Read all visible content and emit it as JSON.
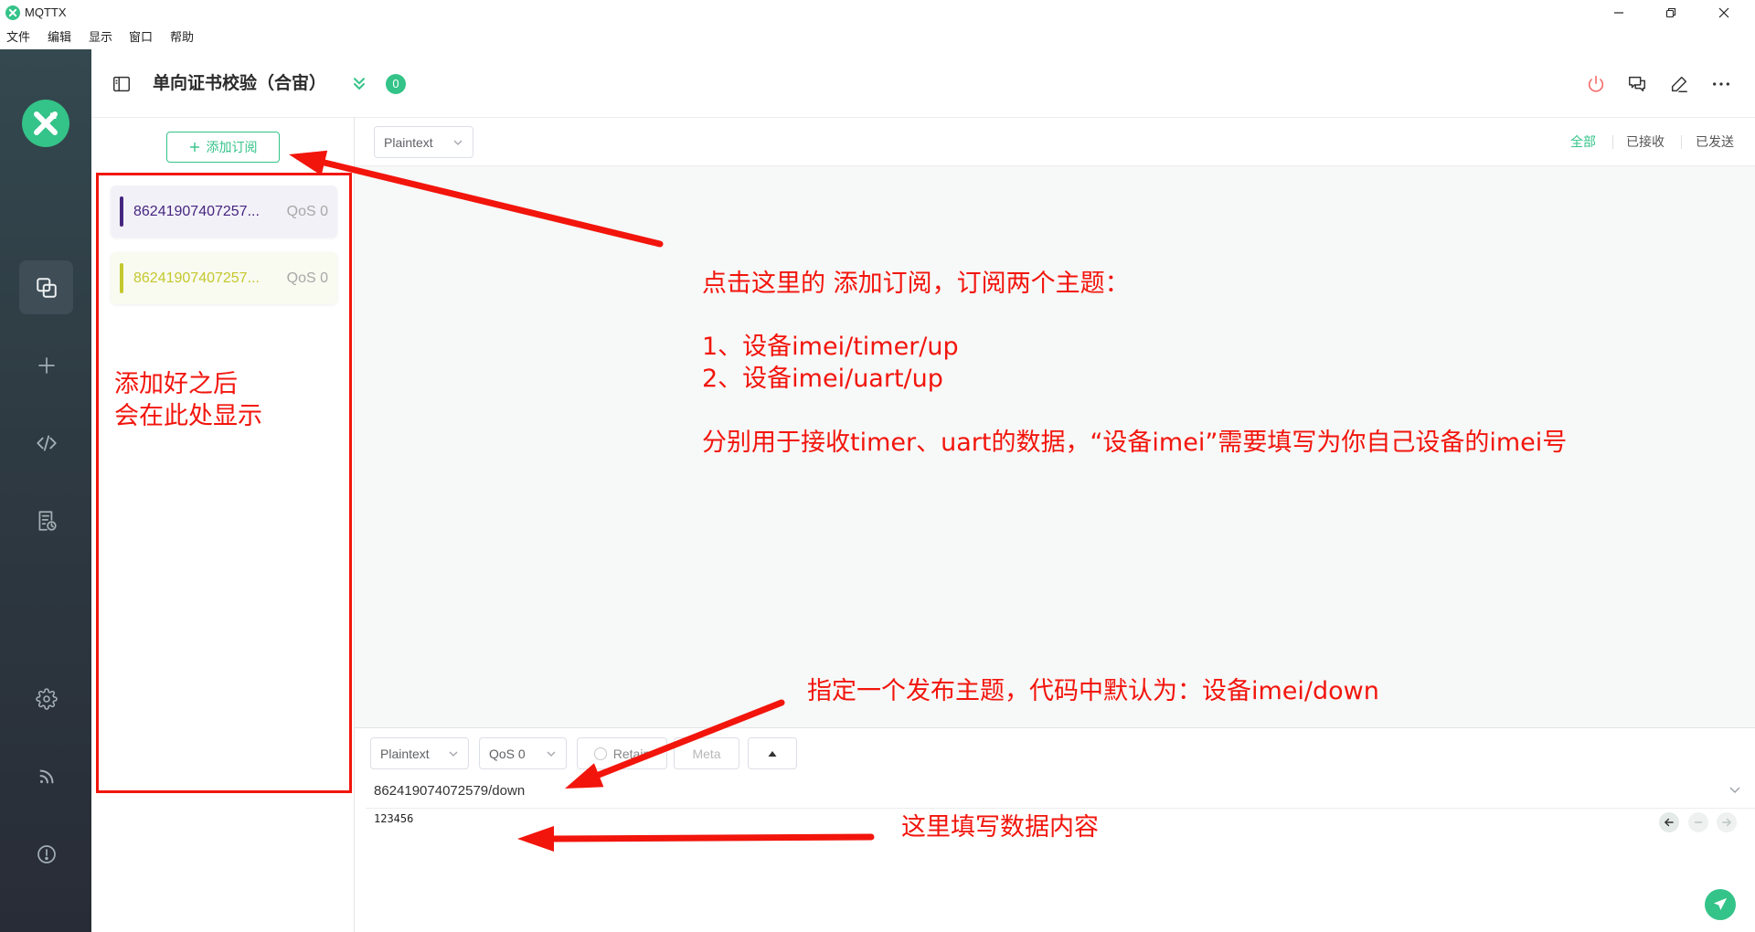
{
  "window": {
    "title": "MQTTX",
    "icon": "mqttx-logo-icon",
    "controls": [
      "minimize-icon",
      "restore-icon",
      "close-icon"
    ]
  },
  "menu": {
    "items": [
      "文件",
      "编辑",
      "显示",
      "窗口",
      "帮助"
    ]
  },
  "sidebar": {
    "logo": "mqttx-logo-icon",
    "items": [
      {
        "id": "connections",
        "icon": "connections-icon",
        "active": true
      },
      {
        "id": "new-connection",
        "icon": "plus-icon"
      },
      {
        "id": "script",
        "icon": "code-icon"
      },
      {
        "id": "log",
        "icon": "log-icon"
      },
      {
        "id": "settings",
        "icon": "gear-icon"
      },
      {
        "id": "feed",
        "icon": "rss-icon"
      },
      {
        "id": "about",
        "icon": "info-icon"
      }
    ]
  },
  "header": {
    "title": "单向证书校验（合宙）",
    "unread_badge": "0",
    "actions": [
      "power-icon",
      "messages-icon",
      "edit-icon",
      "more-icon"
    ]
  },
  "subscriptions": {
    "add_label": "添加订阅",
    "items": [
      {
        "topic": "86241907407257...",
        "qos": "QoS 0",
        "color": "#452680"
      },
      {
        "topic": "86241907407257...",
        "qos": "QoS 0",
        "color": "#c4c82e"
      }
    ]
  },
  "messages": {
    "payload_format": "Plaintext",
    "filters": [
      {
        "label": "全部",
        "active": true
      },
      {
        "label": "已接收",
        "active": false
      },
      {
        "label": "已发送",
        "active": false
      }
    ]
  },
  "publish": {
    "payload_format": "Plaintext",
    "qos": "QoS 0",
    "retain_label": "Retain",
    "meta_label": "Meta",
    "topic": "862419074072579/down",
    "payload": "123456"
  },
  "annotations": {
    "subscription_note": [
      "添加好之后",
      "会在此处显示"
    ],
    "instructions": [
      "点击这里的 添加订阅，订阅两个主题：",
      "1、设备imei/timer/up",
      "2、设备imei/uart/up",
      "分别用于接收timer、uart的数据，“设备imei”需要填写为你自己设备的imei号"
    ],
    "publish_topic_note": "指定一个发布主题，代码中默认为：设备imei/down",
    "payload_note": "这里填写数据内容"
  },
  "colors": {
    "accent": "#34c388",
    "annotation": "#f2150c",
    "power": "#f56c6c",
    "sidebar": "#2e3a42"
  }
}
